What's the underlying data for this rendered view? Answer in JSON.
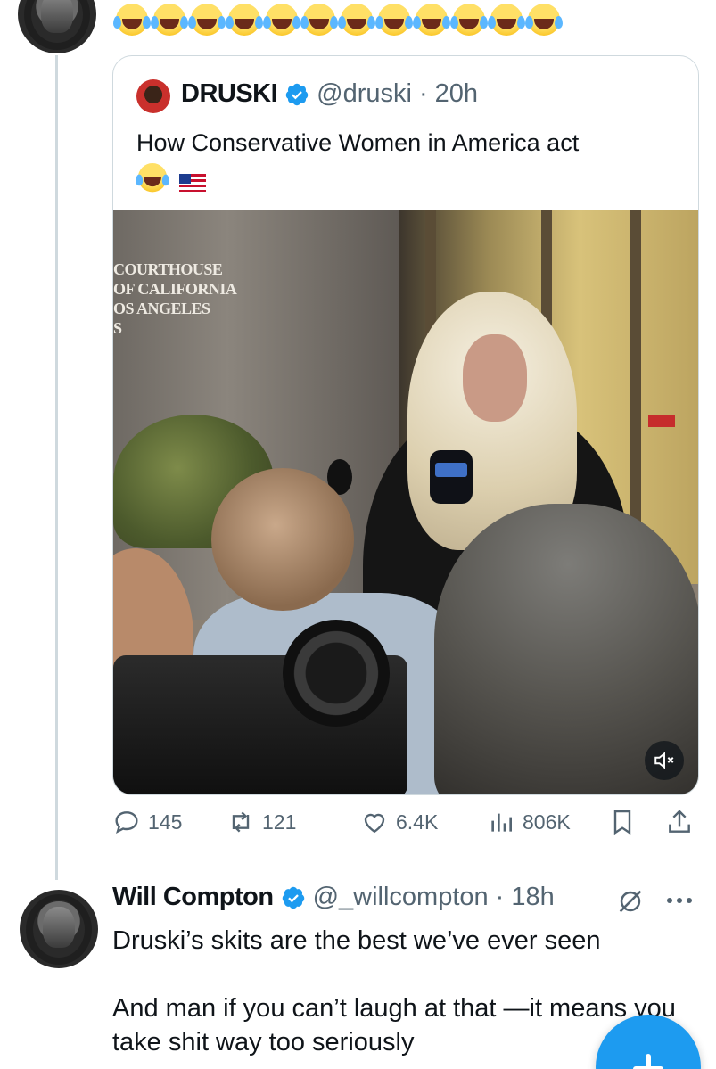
{
  "top_tweet": {
    "emoji_text": "😂😂😂😂😂😂😂😂😂😂😂😂",
    "emoji_count": 12
  },
  "quoted_tweet": {
    "author_name": "DRUSKI",
    "handle": "@druski",
    "separator": "·",
    "time": "20h",
    "text": "How Conservative Women in America act",
    "emoji_text": "😂🇺🇸",
    "media": {
      "sign_text": [
        "COURTHOUSE",
        "OF CALIFORNIA",
        "OS ANGELES",
        "S"
      ]
    }
  },
  "actions": {
    "replies": "145",
    "reposts": "121",
    "likes": "6.4K",
    "views": "806K"
  },
  "reply": {
    "author_name": "Will Compton",
    "handle": "@_willcompton",
    "separator": "·",
    "time": "18h",
    "text_lines": [
      "Druski’s skits are the best we’ve ever seen",
      "And man if you can’t laugh at that —it means you take shit way too seriously"
    ]
  },
  "colors": {
    "accent": "#1d9bf0",
    "secondary_text": "#536471",
    "border": "#cfd9de",
    "verified": "#1d9bf0"
  },
  "icons": {
    "verified": "verified-badge-icon",
    "reply": "reply-icon",
    "repost": "repost-icon",
    "like": "heart-icon",
    "views": "views-icon",
    "bookmark": "bookmark-icon",
    "share": "share-icon",
    "mute": "mute-icon",
    "grok": "grok-icon",
    "more": "more-icon",
    "compose": "compose-plus-icon"
  }
}
